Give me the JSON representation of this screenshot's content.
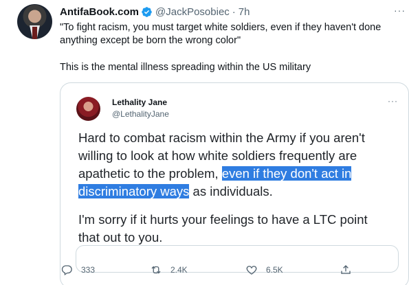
{
  "tweet": {
    "author_name": "AntifaBook.com",
    "author_handle": "@JackPosobiec",
    "separator": "·",
    "time": "7h",
    "more": "···",
    "text_lines": [
      "\"To fight racism, you must target white soldiers, even if they haven't done",
      "anything except be born the wrong color\"",
      "This is the mental illness spreading within the US military"
    ]
  },
  "quote": {
    "author_name": "Lethality Jane",
    "author_handle": "@LethalityJane",
    "more": "···",
    "line1": "Hard to combat racism within the Army if you aren't",
    "line2": "willing to look at how white soldiers frequently are",
    "line3_plain": "apathetic to the problem, ",
    "line3_highlight": "even if they don't act in",
    "line4_highlight": "discriminatory ways",
    "line4_plain": " as individuals.",
    "line5": "I'm sorry if it hurts your feelings to have a LTC point",
    "line6": "that out to you."
  },
  "actions": {
    "replies": "333",
    "retweets": "2.4K",
    "likes": "6.5K"
  },
  "colors": {
    "verified": "#1d9bf0",
    "highlight": "#2f7de1",
    "secondary_text": "#536471"
  },
  "icons": [
    "verified-icon",
    "reply-icon",
    "retweet-icon",
    "like-icon",
    "share-icon"
  ]
}
